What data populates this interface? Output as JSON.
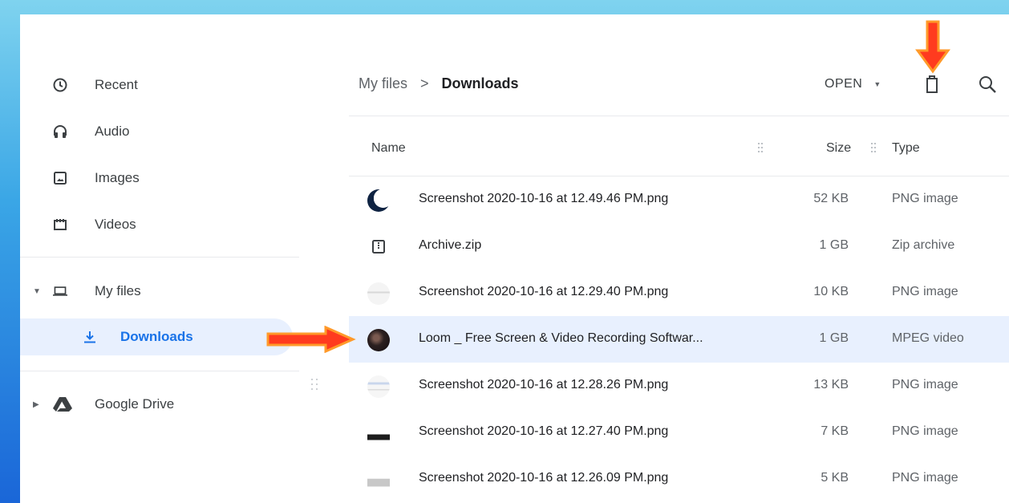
{
  "sidebar": {
    "items": [
      {
        "label": "Recent",
        "icon": "clock-icon"
      },
      {
        "label": "Audio",
        "icon": "headphones-icon"
      },
      {
        "label": "Images",
        "icon": "image-icon"
      },
      {
        "label": "Videos",
        "icon": "video-icon"
      }
    ],
    "my_files": {
      "label": "My files",
      "icon": "laptop-icon"
    },
    "downloads": {
      "label": "Downloads",
      "icon": "download-icon"
    },
    "google_drive": {
      "label": "Google Drive",
      "icon": "drive-icon"
    }
  },
  "breadcrumb": {
    "root": "My files",
    "separator": ">",
    "current": "Downloads"
  },
  "toolbar": {
    "open_label": "OPEN",
    "delete_icon": "trash-icon",
    "search_icon": "search-icon"
  },
  "table": {
    "columns": {
      "name": "Name",
      "size": "Size",
      "type": "Type"
    },
    "rows": [
      {
        "name": "Screenshot 2020-10-16 at 12.49.46 PM.png",
        "size": "52 KB",
        "type": "PNG image"
      },
      {
        "name": "Archive.zip",
        "size": "1 GB",
        "type": "Zip archive"
      },
      {
        "name": "Screenshot 2020-10-16 at 12.29.40 PM.png",
        "size": "10 KB",
        "type": "PNG image"
      },
      {
        "name": "Loom _ Free Screen & Video Recording Softwar...",
        "size": "1 GB",
        "type": "MPEG video"
      },
      {
        "name": "Screenshot 2020-10-16 at 12.28.26 PM.png",
        "size": "13 KB",
        "type": "PNG image"
      },
      {
        "name": "Screenshot 2020-10-16 at 12.27.40 PM.png",
        "size": "7 KB",
        "type": "PNG image"
      },
      {
        "name": "Screenshot 2020-10-16 at 12.26.09 PM.png",
        "size": "5 KB",
        "type": "PNG image"
      }
    ]
  },
  "colors": {
    "accent": "#1a73e8",
    "selected_bg": "#e8f0fe",
    "annotation_arrow": "#ff3b1f"
  }
}
